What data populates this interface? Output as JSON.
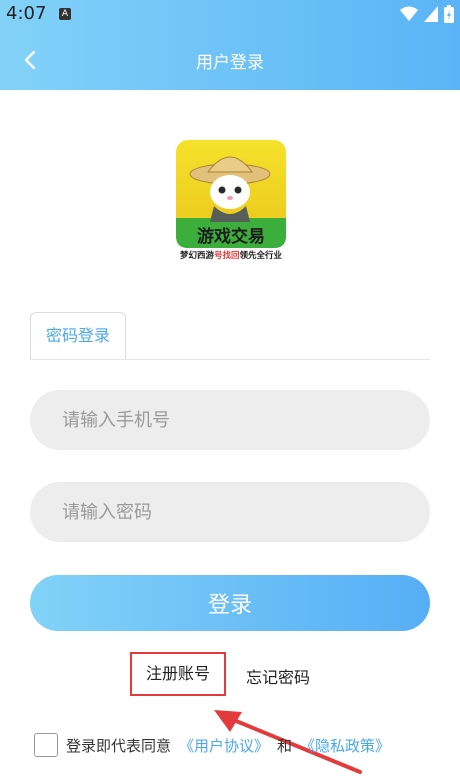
{
  "status_bar": {
    "time": "4:07",
    "notification": "A",
    "icons": [
      "wifi-icon",
      "signal-icon",
      "battery-icon"
    ]
  },
  "header": {
    "title": "用户登录",
    "back_icon": "chevron-left-icon",
    "gradient": [
      "#82d2f8",
      "#5ab4f6"
    ]
  },
  "logo": {
    "title": "游戏交易",
    "tagline_prefix": "梦幻西游",
    "tagline_highlight": "号找回",
    "tagline_suffix": "领先全行业"
  },
  "tabs": [
    {
      "label": "密码登录",
      "active": true
    }
  ],
  "form": {
    "phone_placeholder": "请输入手机号",
    "phone_value": "",
    "password_placeholder": "请输入密码",
    "password_value": "",
    "login_label": "登录"
  },
  "links": {
    "register": "注册账号",
    "forgot": "忘记密码"
  },
  "agreement": {
    "checked": false,
    "prefix": "登录即代表同意",
    "user_agreement": "《用户协议》",
    "conjunction": "和",
    "privacy_policy": "《隐私政策》"
  },
  "colors": {
    "accent": "#4aa8ee",
    "highlight_box": "#e33b3b",
    "input_bg": "#ededed"
  }
}
